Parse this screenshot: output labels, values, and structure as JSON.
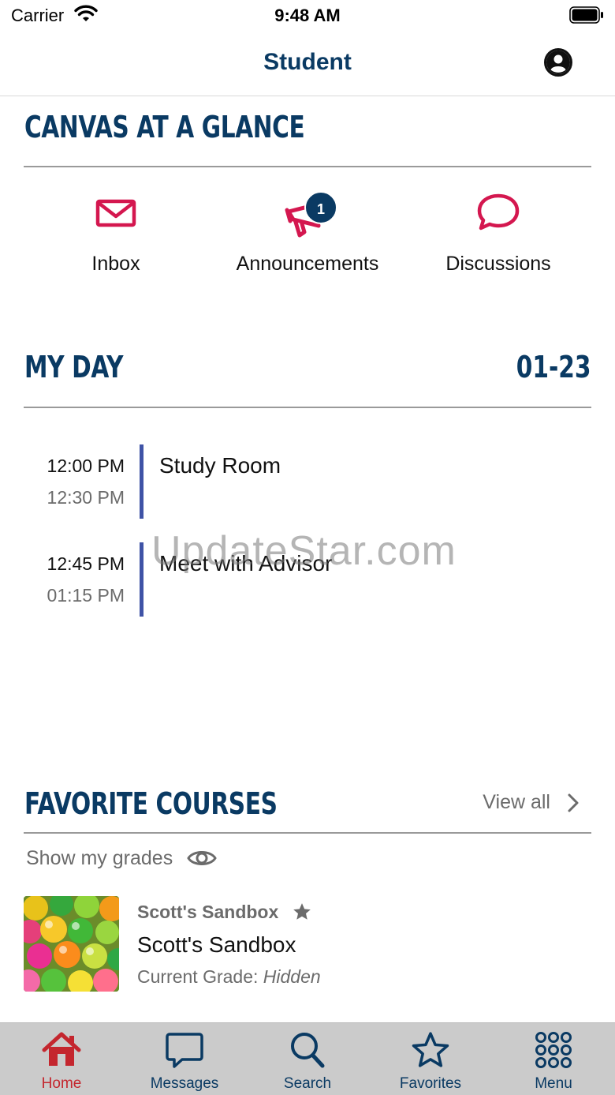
{
  "status_bar": {
    "carrier": "Carrier",
    "time": "9:48 AM"
  },
  "nav": {
    "title": "Student"
  },
  "glance": {
    "title": "CANVAS AT A GLANCE",
    "items": [
      {
        "label": "Inbox",
        "icon": "envelope-icon"
      },
      {
        "label": "Announcements",
        "icon": "megaphone-icon",
        "badge": "1"
      },
      {
        "label": "Discussions",
        "icon": "speech-bubble-icon"
      }
    ]
  },
  "my_day": {
    "title": "MY DAY",
    "date": "01-23",
    "events": [
      {
        "start": "12:00 PM",
        "end": "12:30 PM",
        "title": "Study Room"
      },
      {
        "start": "12:45 PM",
        "end": "01:15 PM",
        "title": "Meet with Advisor"
      }
    ]
  },
  "watermark": "UpdateStar.com",
  "favorites": {
    "title": "FAVORITE COURSES",
    "view_all": "View all",
    "show_grades": "Show my grades",
    "courses": [
      {
        "code": "Scott's Sandbox",
        "name": "Scott's Sandbox",
        "grade_label": "Current Grade:",
        "grade_value": "Hidden"
      }
    ]
  },
  "tabs": [
    {
      "label": "Home",
      "icon": "home-icon",
      "active": true
    },
    {
      "label": "Messages",
      "icon": "chat-icon"
    },
    {
      "label": "Search",
      "icon": "search-icon"
    },
    {
      "label": "Favorites",
      "icon": "star-icon"
    },
    {
      "label": "Menu",
      "icon": "grid-icon"
    }
  ],
  "colors": {
    "brand_navy": "#0a3a63",
    "accent_red": "#c4262e",
    "glance_icon_pink": "#d4174f",
    "event_bar": "#3f53a6"
  }
}
